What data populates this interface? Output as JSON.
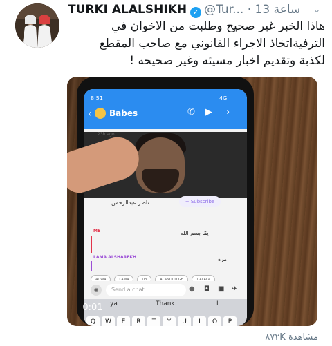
{
  "tweet": {
    "author_name": "TURKI ALALSHIKH",
    "handle": "@Tur...",
    "separator": "·",
    "time": "13 ساعة",
    "text_lines": [
      "هاذا الخبر غير صحيح وطلبت من الاخوان في",
      "الترفيةاتخاذ الاجراء القانوني مع صاحب المقطع",
      "لكذبة وتقديم اخبار مسيئه وغير صحيحه !"
    ],
    "views_count": "٨٧٢K",
    "views_label": "مشاهدة"
  },
  "video": {
    "timer": "0:01",
    "phone_status_time": "8:51",
    "phone_status_right": "4G",
    "chat_title": "Babes",
    "story_age": "23h ago",
    "subscriber_name": "ناصر عبدالرحمن",
    "subscribe_label": "+ Subscribe",
    "me_label": "ME",
    "me_message": "يمّا بسم الله",
    "lama_label": "LAMA ALSHAREKH",
    "lama_message": "مرة",
    "chips": [
      "ADWA",
      "LAMA",
      "U3",
      "ALANOUD GH",
      "DALALA"
    ],
    "input_placeholder": "Send a chat",
    "suggestions": [
      "ya",
      "Thank",
      "I"
    ],
    "keys": [
      "Q",
      "W",
      "E",
      "R",
      "T",
      "Y",
      "U",
      "I",
      "O",
      "P"
    ]
  },
  "colors": {
    "verified_blue": "#1da1f2",
    "snap_blue": "#2b8cf0",
    "secondary_text": "#657786"
  }
}
